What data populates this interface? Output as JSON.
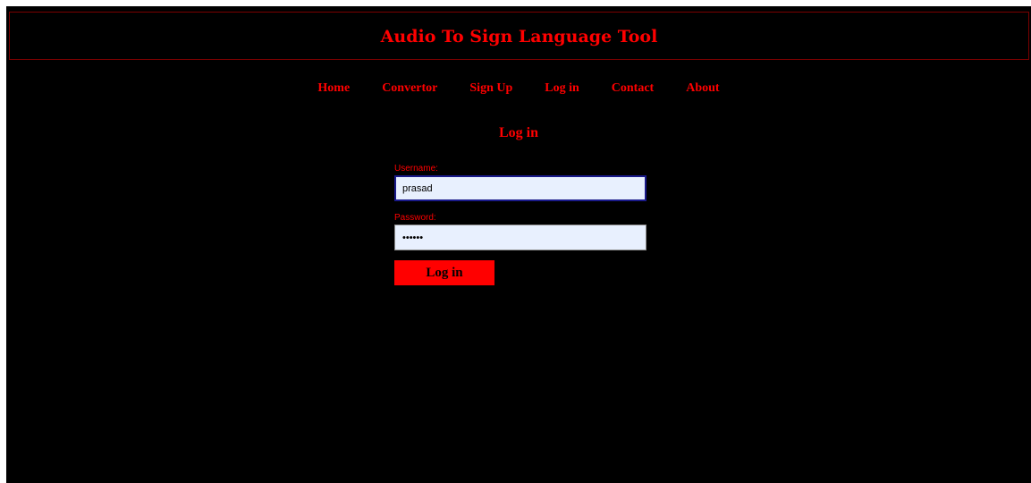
{
  "header": {
    "title": "Audio To Sign Language Tool"
  },
  "nav": {
    "items": [
      "Home",
      "Convertor",
      "Sign Up",
      "Log in",
      "Contact",
      "About"
    ]
  },
  "main": {
    "heading": "Log in",
    "username": {
      "label": "Username:",
      "value": "prasad"
    },
    "password": {
      "label": "Password:",
      "value": "••••••"
    },
    "submit_label": "Log in"
  },
  "colors": {
    "background": "#000000",
    "accent": "#ff0000",
    "input_background": "#e8f0fe"
  }
}
